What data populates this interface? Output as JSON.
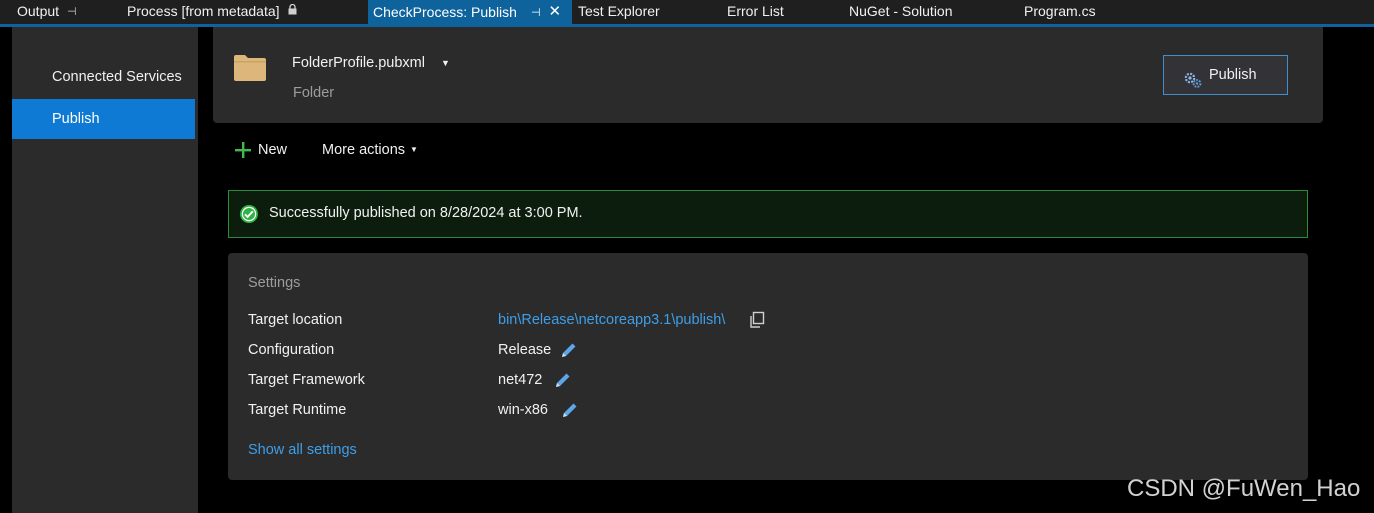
{
  "tabs": [
    {
      "label": "Output",
      "icon": "pin-icon"
    },
    {
      "label": "Process [from metadata]",
      "icon": "lock-icon"
    },
    {
      "label": "CheckProcess: Publish",
      "active": true,
      "icon": "pin-icon"
    },
    {
      "label": "Test Explorer"
    },
    {
      "label": "Error List"
    },
    {
      "label": "NuGet - Solution"
    },
    {
      "label": "Program.cs"
    }
  ],
  "glyphs": {
    "pin": "⊣",
    "lock": "🔒",
    "close": "✕",
    "caret": "▼"
  },
  "nav": {
    "items": [
      {
        "label": "Connected Services",
        "selected": false
      },
      {
        "label": "Publish",
        "selected": true
      }
    ]
  },
  "profile": {
    "name": "FolderProfile.pubxml",
    "type": "Folder",
    "publish_label": "Publish"
  },
  "actions": {
    "new_label": "New",
    "more_label": "More actions"
  },
  "banner": {
    "message": "Successfully published on 8/28/2024 at 3:00 PM."
  },
  "settings": {
    "title": "Settings",
    "rows": [
      {
        "label": "Target location",
        "value": "bin\\Release\\netcoreapp3.1\\publish\\",
        "link": true,
        "icon": "copy-icon"
      },
      {
        "label": "Configuration",
        "value": "Release",
        "icon": "pencil-icon"
      },
      {
        "label": "Target Framework",
        "value": "net472",
        "icon": "pencil-icon"
      },
      {
        "label": "Target Runtime",
        "value": "win-x86",
        "icon": "pencil-icon"
      }
    ],
    "show_all": "Show all settings"
  },
  "watermark": "CSDN @FuWen_Hao",
  "colors": {
    "accent": "#0e639c",
    "nav_selected": "#0e7ad3",
    "link": "#3e9ee8",
    "success_border": "#2e8b3e",
    "success_icon": "#2fb344",
    "panel": "#2b2b2b",
    "folder": "#dcb67a"
  }
}
